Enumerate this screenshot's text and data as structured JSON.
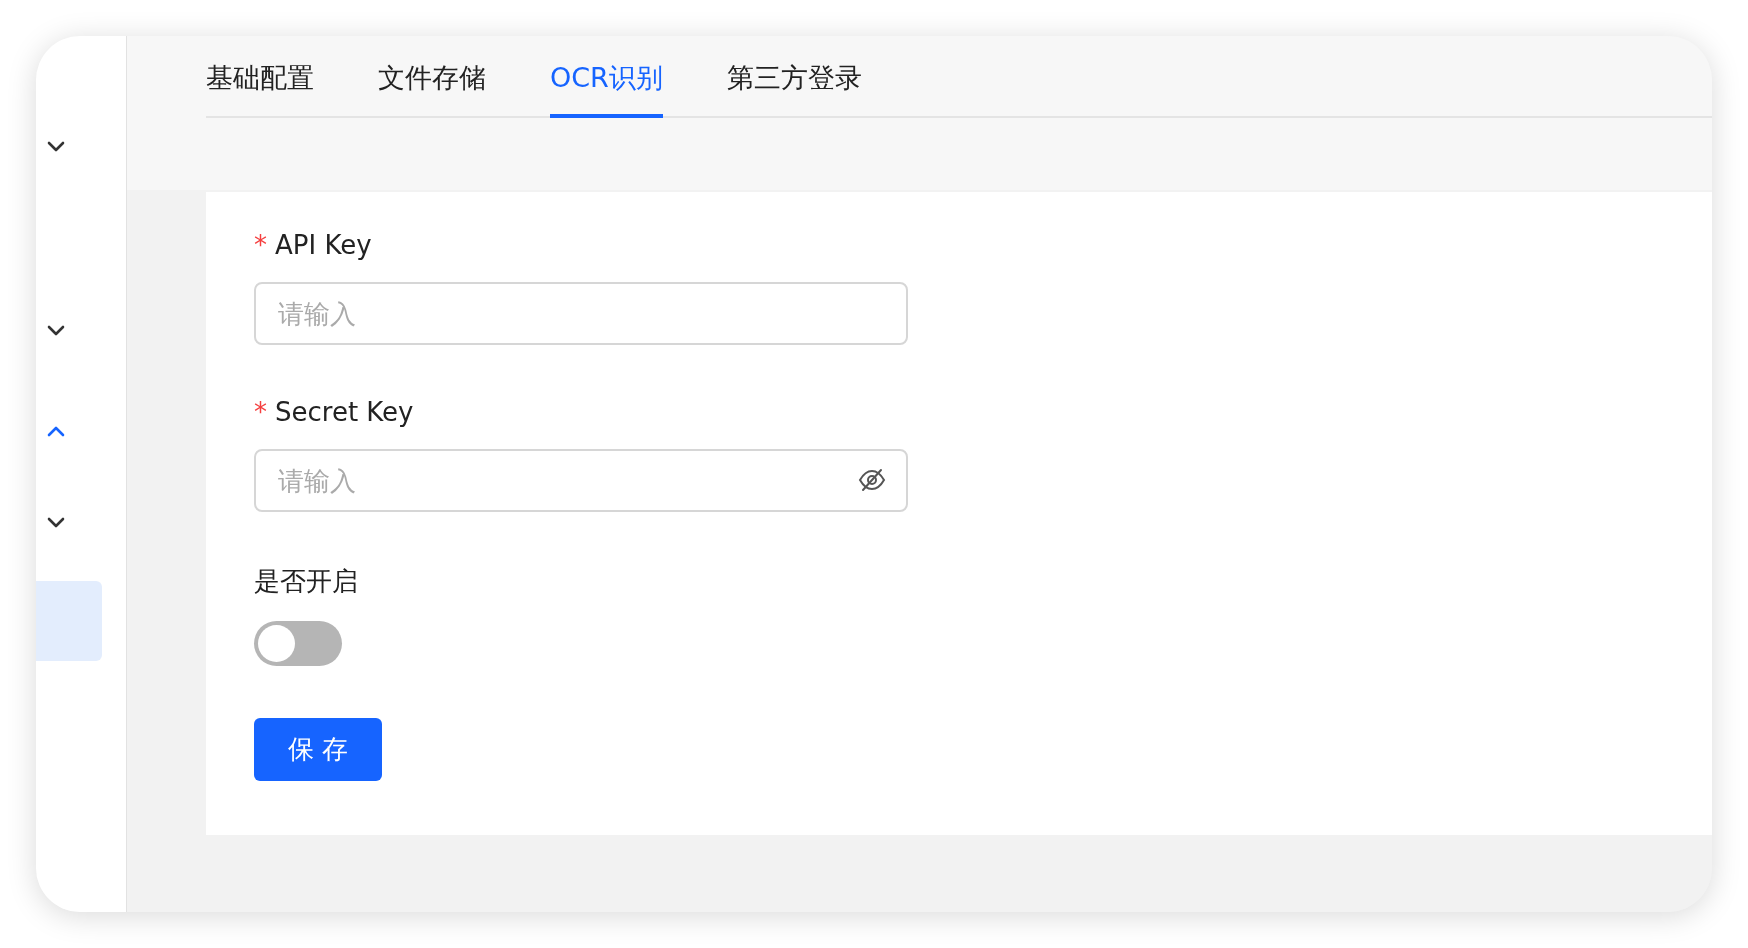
{
  "sidebar": {
    "groups": [
      {
        "expanded": false
      },
      {
        "expanded": false
      },
      {
        "expanded": true
      },
      {
        "expanded": false
      }
    ],
    "active_item": {
      "selected": true
    }
  },
  "tabs": [
    {
      "label": "基础配置",
      "selected": false
    },
    {
      "label": "文件存储",
      "selected": false
    },
    {
      "label": "OCR识别",
      "selected": true
    },
    {
      "label": "第三方登录",
      "selected": false
    }
  ],
  "form": {
    "fields": [
      {
        "kind": "text",
        "label": "API Key",
        "required": true,
        "placeholder": "请输入"
      },
      {
        "kind": "password",
        "label": "Secret Key",
        "required": true,
        "placeholder": "请输入",
        "show_password": false
      },
      {
        "kind": "switch",
        "label": "是否开启",
        "required": false,
        "on": false
      }
    ],
    "required_mark": "*",
    "save_button": "保 存"
  }
}
